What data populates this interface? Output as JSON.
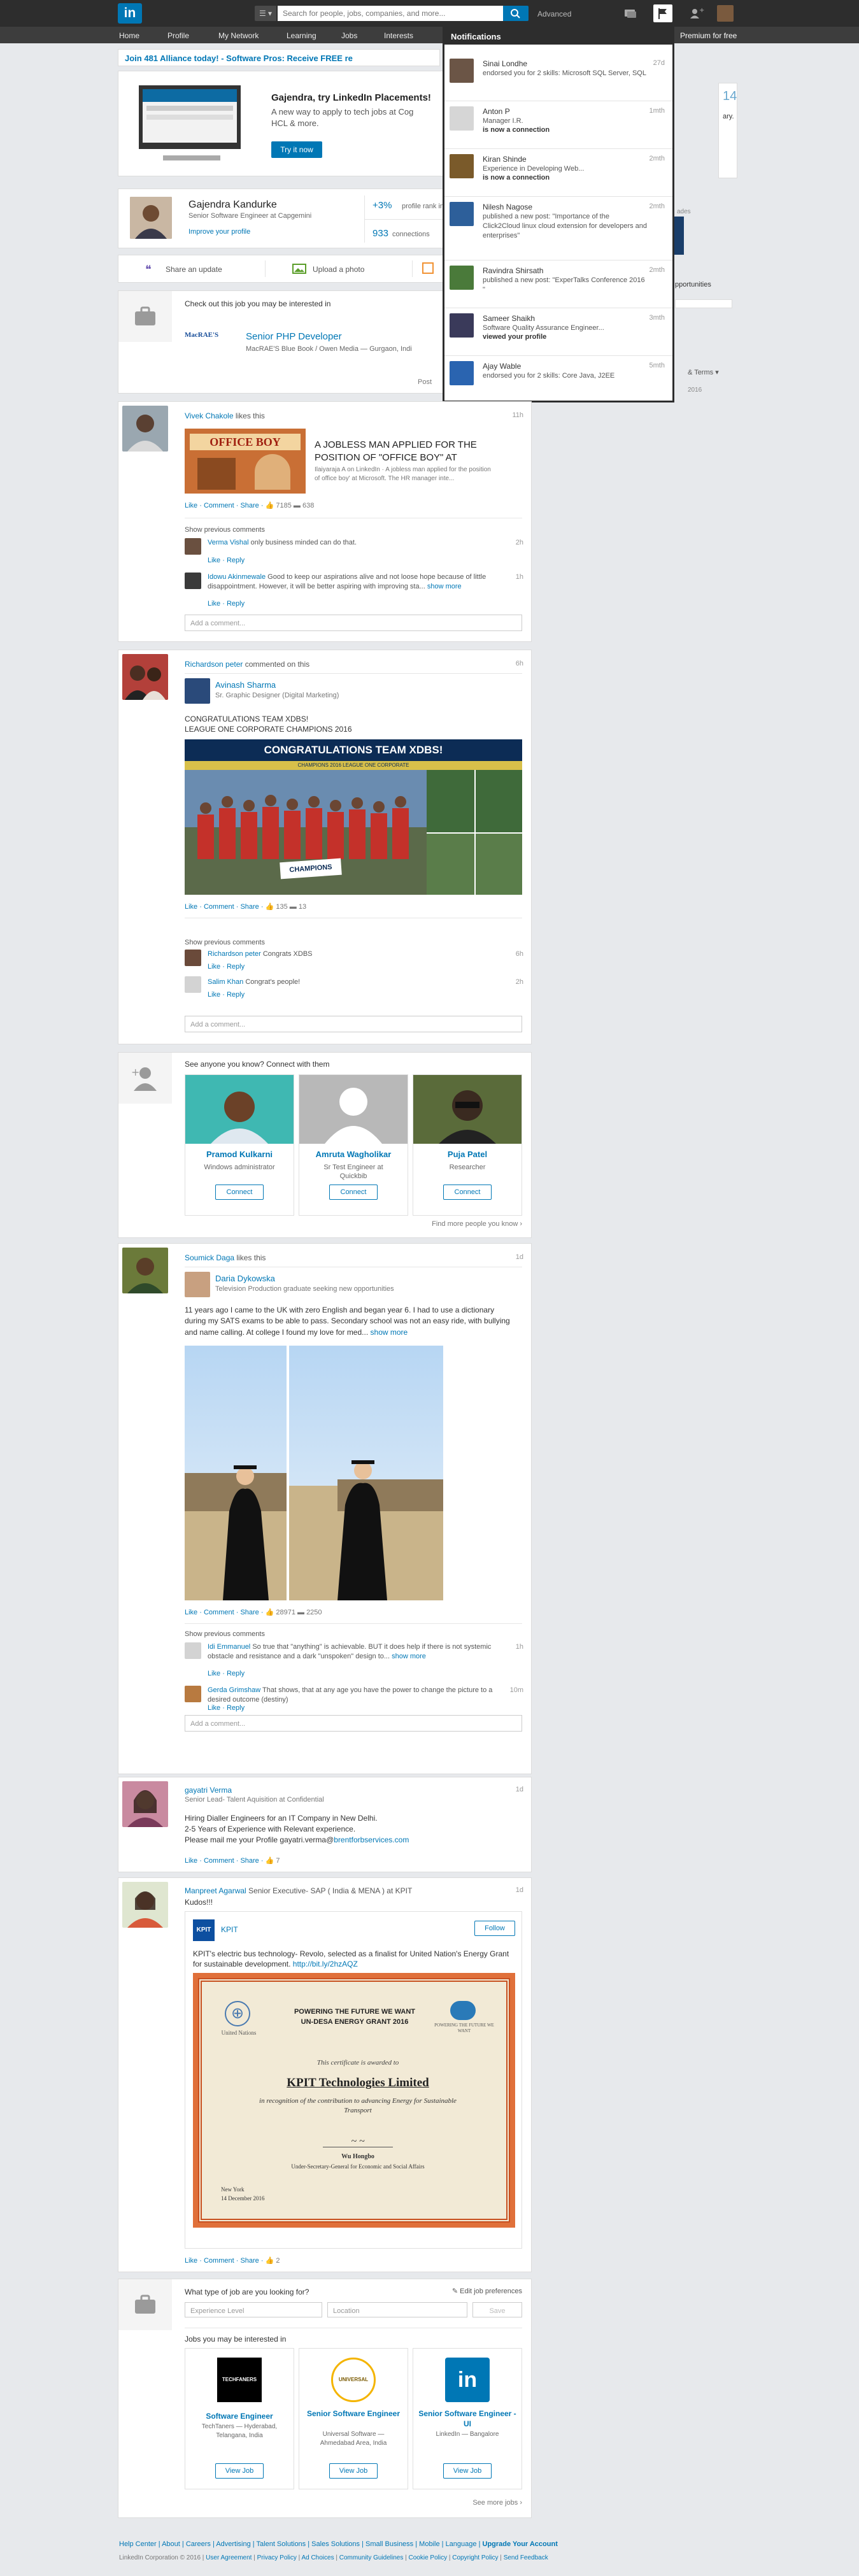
{
  "nav": {
    "logo": "in",
    "search_type": "☰ ▾",
    "search_placeholder": "Search for people, jobs, companies, and more...",
    "advanced": "Advanced",
    "items": [
      "Home",
      "Profile",
      "My Network",
      "Learning",
      "Jobs",
      "Interests"
    ],
    "premium": "Premium for free"
  },
  "banner": "Join 481 Alliance today! - Software Pros: Receive FREE re",
  "ad": {
    "title": "Gajendra, try LinkedIn Placements!",
    "text": "A new way to apply to tech jobs at Cog HCL & more.",
    "button": "Try it now",
    "side_num": "14",
    "side_text": "ary."
  },
  "profile": {
    "name": "Gajendra Kandurke",
    "title": "Senior Software Engineer at Capgemini",
    "improve": "Improve your profile",
    "rank_pct": "+3%",
    "rank_label": "profile rank in",
    "connections": "933",
    "connections_label": "connections",
    "side_ads": "ades"
  },
  "share": {
    "update": "Share an update",
    "photo": "Upload a photo",
    "write": "W"
  },
  "right_side": {
    "opportunities": "pportunities",
    "terms": "& Terms ▾",
    "year": "2016"
  },
  "job_card": {
    "header": "Check out this job you may be interested in",
    "company_logo": "MacRAE'S",
    "title": "Senior PHP Developer",
    "subtitle": "MacRAE'S Blue Book / Owen Media — Gurgaon, Indi",
    "post": "Post"
  },
  "notifications": {
    "title": "Notifications",
    "items": [
      {
        "name": "Sinai Londhe",
        "time": "27d",
        "line1": "endorsed you for 2 skills: Microsoft SQL Server, SQL",
        "line2": ""
      },
      {
        "name": "Anton P",
        "time": "1mth",
        "line1": "Manager I.R.",
        "line2": "is now a connection"
      },
      {
        "name": "Kiran Shinde",
        "time": "2mth",
        "line1": "Experience in Developing Web...",
        "line2": "is now a connection"
      },
      {
        "name": "Nilesh Nagose",
        "time": "2mth",
        "line1": "published a new post: \"Importance of the Click2Cloud linux cloud extension for developers and enterprises\"",
        "line2": ""
      },
      {
        "name": "Ravindra Shirsath",
        "time": "2mth",
        "line1": "published a new post: \"ExperTalks Conference 2016 \"",
        "line2": ""
      },
      {
        "name": "Sameer Shaikh",
        "time": "3mth",
        "line1": "Software Quality Assurance Engineer...",
        "line2": "viewed your profile"
      },
      {
        "name": "Ajay Wable",
        "time": "5mth",
        "line1": "endorsed you for 2 skills: Core Java, J2EE",
        "line2": ""
      }
    ]
  },
  "post1": {
    "actor": "Vivek Chakole",
    "verb": "likes this",
    "time": "11h",
    "share_title": "A JOBLESS MAN APPLIED FOR THE POSITION OF \"OFFICE BOY\" AT",
    "share_source": "Ilaiyaraja A on LinkedIn",
    "share_desc": "A jobless man applied for the position of office boy' at Microsoft. The HR manager inte...",
    "thumb_text": "OFFICE BOY",
    "like": "Like",
    "comment": "Comment",
    "share": "Share",
    "likes": "7185",
    "comments": "638",
    "show_prev": "Show previous comments",
    "c1_name": "Verma Vishal",
    "c1_text": "only business minded can do that.",
    "c1_time": "2h",
    "c2_name": "Idowu Akinmewale",
    "c2_text": "Good to keep our aspirations alive and not loose hope because of little disappointment. However, it will be better aspiring with improving sta...",
    "c2_more": "show more",
    "c2_time": "1h",
    "reply": "Reply",
    "add_comment": "Add a comment..."
  },
  "post2": {
    "actor": "Richardson peter",
    "verb": "commented on this",
    "time": "6h",
    "author": "Avinash Sharma",
    "author_title": "Sr. Graphic Designer (Digital Marketing)",
    "text1": "CONGRATULATIONS TEAM XDBS!",
    "text2": "LEAGUE ONE CORPORATE CHAMPIONS 2016",
    "img_title": "CONGRATULATIONS TEAM XDBS!",
    "img_sub": "CHAMPIONS 2016 LEAGUE ONE CORPORATE",
    "img_banner": "CHAMPIONS",
    "likes": "135",
    "comments": "13",
    "c1_name": "Richardson peter",
    "c1_text": "Congrats XDBS",
    "c1_time": "6h",
    "c2_name": "Salim Khan",
    "c2_text": "Congrat's people!",
    "c2_time": "2h"
  },
  "pymk": {
    "header": "See anyone you know? Connect with them",
    "people": [
      {
        "name": "Pramod Kulkarni",
        "title": "Windows administrator",
        "btn": "Connect"
      },
      {
        "name": "Amruta Wagholikar",
        "title": "Sr Test Engineer at Quickbib",
        "btn": "Connect"
      },
      {
        "name": "Puja Patel",
        "title": "Researcher",
        "btn": "Connect"
      }
    ],
    "more": "Find more people you know ›"
  },
  "post3": {
    "actor": "Soumick Daga",
    "verb": "likes this",
    "time": "1d",
    "author": "Daria Dykowska",
    "author_title": "Television Production graduate seeking new opportunities",
    "text": "11 years ago I came to the UK with zero English and began year 6. I had to use a dictionary during my SATS exams to be able to pass. Secondary school was not an easy ride, with bullying and name calling. At college I found my love for med...",
    "more": "show more",
    "likes": "28971",
    "comments": "2250",
    "c1_name": "Idi Emmanuel",
    "c1_text": "So true that \"anything\" is achievable. BUT it does help if there is not systemic obstacle and resistance and a dark \"unspoken\" design to...",
    "c1_more": "show more",
    "c1_time": "1h",
    "c2_name": "Gerda Grimshaw",
    "c2_text": "That shows, that at any age you have the power to change the picture to a desired outcome (destiny)",
    "c2_time": "10m"
  },
  "post4": {
    "actor": "gayatri Verma",
    "subtitle": "Senior Lead- Talent Aquisition at Confidential",
    "time": "1d",
    "line1": "Hiring Dialler Engineers for an IT Company in New Delhi.",
    "line2": "2-5 Years of Experience with Relevant experience.",
    "line3_pre": "Please mail me your Profile gayatri.verma@",
    "line3_link": "brentforbservices.com",
    "likes": "7"
  },
  "post5": {
    "actor": "Manpreet Agarwal",
    "subtitle": "Senior Executive- SAP ( India & MENA ) at KPIT",
    "time": "1d",
    "kudos": "Kudos!!!",
    "company": "KPIT",
    "follow": "Follow",
    "text": "KPIT's electric bus technology- Revolo, selected as a finalist for United Nation's Energy Grant for sustainable development.",
    "link": "http://bit.ly/2hzAQZ",
    "cert_un": "United Nations",
    "cert_title": "POWERING THE FUTURE WE WANT",
    "cert_sub": "UN-DESA ENERGY GRANT 2016",
    "cert_award": "This certificate is awarded to",
    "cert_company": "KPIT Technologies Limited",
    "cert_reason": "in recognition of the contribution to advancing Energy for Sustainable Transport",
    "cert_sign": "Wu Hongbo",
    "cert_sign_title": "Under-Secretary-General for Economic and Social Affairs",
    "cert_place": "New York",
    "cert_date": "14 December 2016",
    "cert_logo2": "POWERING THE FUTURE WE WANT",
    "likes": "2"
  },
  "jobs": {
    "question": "What type of job are you looking for?",
    "edit": "Edit job preferences",
    "experience": "Experience Level",
    "location": "Location",
    "save": "Save",
    "header": "Jobs you may be interested in",
    "items": [
      {
        "logo": "TECHFANERS",
        "title": "Software Engineer",
        "company": "TechTaners — Hyderabad, Telangana, India",
        "btn": "View Job"
      },
      {
        "logo": "UNIVERSAL",
        "title": "Senior Software Engineer",
        "company": "Universal Software — Ahmedabad Area, India",
        "btn": "View Job"
      },
      {
        "logo": "in",
        "title": "Senior Software Engineer - UI",
        "company": "LinkedIn — Bangalore",
        "btn": "View Job"
      }
    ],
    "more": "See more jobs ›"
  },
  "footer": {
    "links1": [
      "Help Center",
      "About",
      "Careers",
      "Advertising",
      "Talent Solutions",
      "Sales Solutions",
      "Small Business",
      "Mobile",
      "Language",
      "Upgrade Your Account"
    ],
    "copyright": "LinkedIn Corporation © 2016",
    "links2": [
      "User Agreement",
      "Privacy Policy",
      "Ad Choices",
      "Community Guidelines",
      "Cookie Policy",
      "Copyright Policy",
      "Send Feedback"
    ]
  },
  "colors": {
    "accent": "#0077b5",
    "topbar": "#2d2d2d",
    "navbar": "#3d3d3d",
    "background": "#e7e9ec"
  }
}
